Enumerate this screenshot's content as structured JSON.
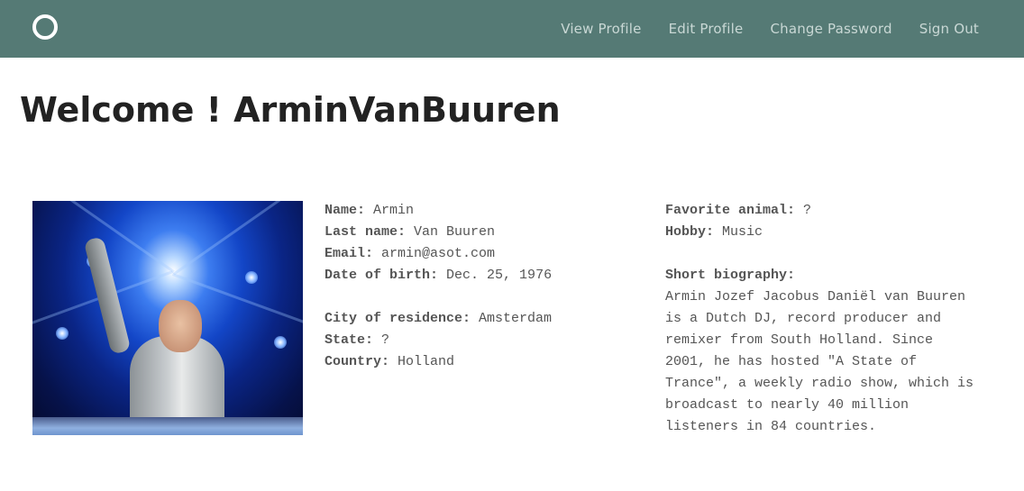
{
  "navbar": {
    "logo_icon": "circle-logo-icon",
    "links": [
      "View Profile",
      "Edit Profile",
      "Change Password",
      "Sign Out"
    ]
  },
  "welcome": "Welcome ! ArminVanBuuren",
  "photo": {
    "subject": "profile-photo"
  },
  "profile": {
    "name_label": "Name:",
    "name": "Armin",
    "lastname_label": "Last name:",
    "lastname": "Van Buuren",
    "email_label": "Email:",
    "email": "armin@asot.com",
    "dob_label": "Date of birth:",
    "dob": "Dec. 25, 1976",
    "city_label": "City of residence:",
    "city": "Amsterdam",
    "state_label": "State:",
    "state": "?",
    "country_label": "Country:",
    "country": "Holland",
    "animal_label": "Favorite animal:",
    "animal": "?",
    "hobby_label": "Hobby:",
    "hobby": "Music",
    "bio_label": "Short biography:",
    "bio": "Armin Jozef Jacobus Daniël van Buuren is a Dutch DJ, record producer and remixer from South Holland. Since 2001, he has hosted \"A State of Trance\", a weekly radio show, which is broadcast to nearly 40 million listeners in 84 countries."
  },
  "colors": {
    "navbar": "#557a75",
    "nav_link": "#c9d8d5",
    "heading": "#222222",
    "text": "#555555"
  }
}
